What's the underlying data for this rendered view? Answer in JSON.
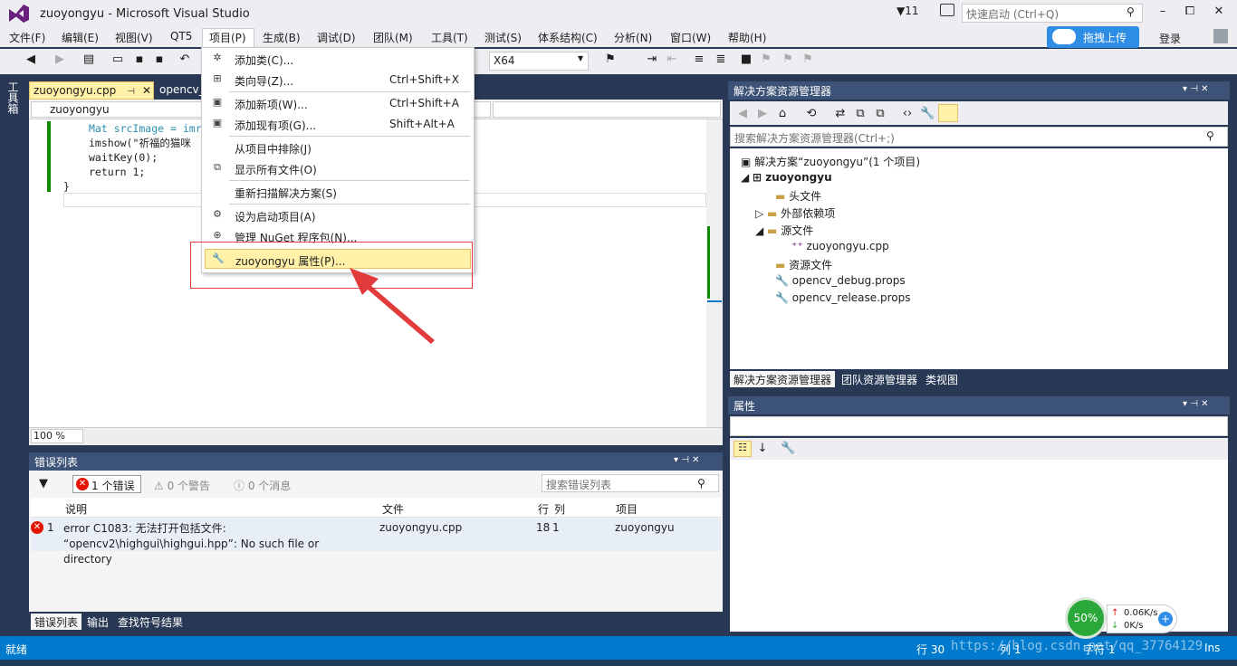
{
  "window": {
    "title": "zuoyongyu - Microsoft Visual Studio",
    "filter_count": "11",
    "quick_launch_placeholder": "快速启动 (Ctrl+Q)",
    "minimize": "–",
    "maximize": "⧠",
    "close": "✕"
  },
  "menubar": {
    "items": [
      "文件(F)",
      "编辑(E)",
      "视图(V)",
      "QT5",
      "项目(P)",
      "生成(B)",
      "调试(D)",
      "团队(M)",
      "工具(T)",
      "测试(S)",
      "体系结构(C)",
      "分析(N)",
      "窗口(W)",
      "帮助(H)"
    ],
    "upload_label": "拖拽上传",
    "login_label": "登录"
  },
  "toolbar": {
    "platform": "X64"
  },
  "toolbox": {
    "label": "工具箱"
  },
  "editor": {
    "tabs": [
      {
        "label": "zuoyongyu.cpp",
        "active": true
      },
      {
        "label": "opencv_"
      }
    ],
    "scope_dropdown": "zuoyongyu",
    "code_lines": [
      "Mat srcImage = imr",
      "imshow(\"祈福的猫咪",
      "waitKey(0);",
      "return 1;",
      "}"
    ],
    "code_tail": "\");",
    "zoom": "100 %"
  },
  "project_menu": {
    "items": [
      {
        "label": "添加类(C)...",
        "shortcut": ""
      },
      {
        "label": "类向导(Z)...",
        "shortcut": "Ctrl+Shift+X"
      },
      {
        "label": "添加新项(W)...",
        "shortcut": "Ctrl+Shift+A"
      },
      {
        "label": "添加现有项(G)...",
        "shortcut": "Shift+Alt+A"
      },
      {
        "label": "从项目中排除(J)",
        "shortcut": ""
      },
      {
        "label": "显示所有文件(O)",
        "shortcut": ""
      },
      {
        "label": "重新扫描解决方案(S)",
        "shortcut": ""
      },
      {
        "label": "设为启动项目(A)",
        "shortcut": ""
      },
      {
        "label": "管理 NuGet 程序包(N)...",
        "shortcut": ""
      },
      {
        "label": "zuoyongyu 属性(P)...",
        "shortcut": "",
        "highlighted": true
      }
    ]
  },
  "error_list": {
    "title": "错误列表",
    "errors_btn": "1 个错误",
    "warnings_btn": "0 个警告",
    "messages_btn": "0 个消息",
    "search_placeholder": "搜索错误列表",
    "columns": [
      "说明",
      "文件",
      "行",
      "列",
      "项目"
    ],
    "rows": [
      {
        "index": "1",
        "description": "error C1083: 无法打开包括文件: “opencv2\\highgui\\highgui.hpp”: No such file or directory",
        "file": "zuoyongyu.cpp",
        "line": "18",
        "col": "1",
        "project": "zuoyongyu"
      }
    ],
    "bottom_tabs": [
      "错误列表",
      "输出",
      "查找符号结果"
    ]
  },
  "solution_explorer": {
    "title": "解决方案资源管理器",
    "search_placeholder": "搜索解决方案资源管理器(Ctrl+;)",
    "tree": [
      {
        "label": "解决方案“zuoyongyu”(1 个项目)",
        "level": 0
      },
      {
        "label": "zuoyongyu",
        "level": 1,
        "bold": true
      },
      {
        "label": "头文件",
        "level": 2
      },
      {
        "label": "外部依赖项",
        "level": 2
      },
      {
        "label": "源文件",
        "level": 2
      },
      {
        "label": "zuoyongyu.cpp",
        "level": 3
      },
      {
        "label": "资源文件",
        "level": 2
      },
      {
        "label": "opencv_debug.props",
        "level": 2
      },
      {
        "label": "opencv_release.props",
        "level": 2
      }
    ],
    "tabs": [
      "解决方案资源管理器",
      "团队资源管理器",
      "类视图"
    ]
  },
  "properties": {
    "title": "属性"
  },
  "statusbar": {
    "left": "就绪",
    "row": "行 30",
    "col": "列 1",
    "char": "字符 1",
    "mode": "Ins"
  },
  "net_widget": {
    "percent": "50%",
    "up": "0.06K/s",
    "down": "0K/s"
  },
  "watermark": "https://blog.csdn.net/qq_37764129",
  "colors": {
    "accent": "#007acc",
    "panel_header": "#3d5277",
    "frame": "#293955",
    "highlight": "#fff1a8",
    "error": "#e51400",
    "annotation": "#e23b3b"
  }
}
